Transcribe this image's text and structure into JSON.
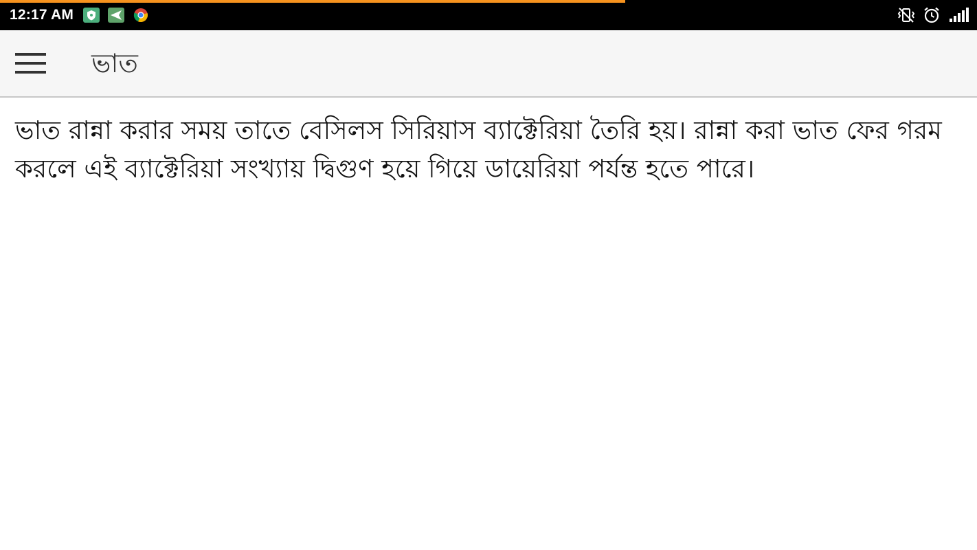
{
  "status_bar": {
    "time": "12:17 AM",
    "progress_fraction": 0.64,
    "notification_icons": [
      "shield-app-icon",
      "messenger-app-icon",
      "chrome-icon"
    ],
    "system_icons": [
      "vibrate-icon",
      "alarm-icon",
      "signal-icon"
    ],
    "background_color": "#000000",
    "progress_color": "#f7931e"
  },
  "app_bar": {
    "menu_icon": "hamburger-menu-icon",
    "title": "ভাত",
    "background_color": "#f6f6f6"
  },
  "content": {
    "paragraph": "ভাত রান্না করার সময় তাতে বেসিলস সিরিয়াস ব্যাক্টেরিয়া তৈরি হয়। রান্না করা ভাত ফের গরম করলে এই ব্যাক্টেরিয়া সংখ্যায় দ্বিগুণ হয়ে গিয়ে ডায়েরিয়া পর্যন্ত হতে পারে।"
  }
}
